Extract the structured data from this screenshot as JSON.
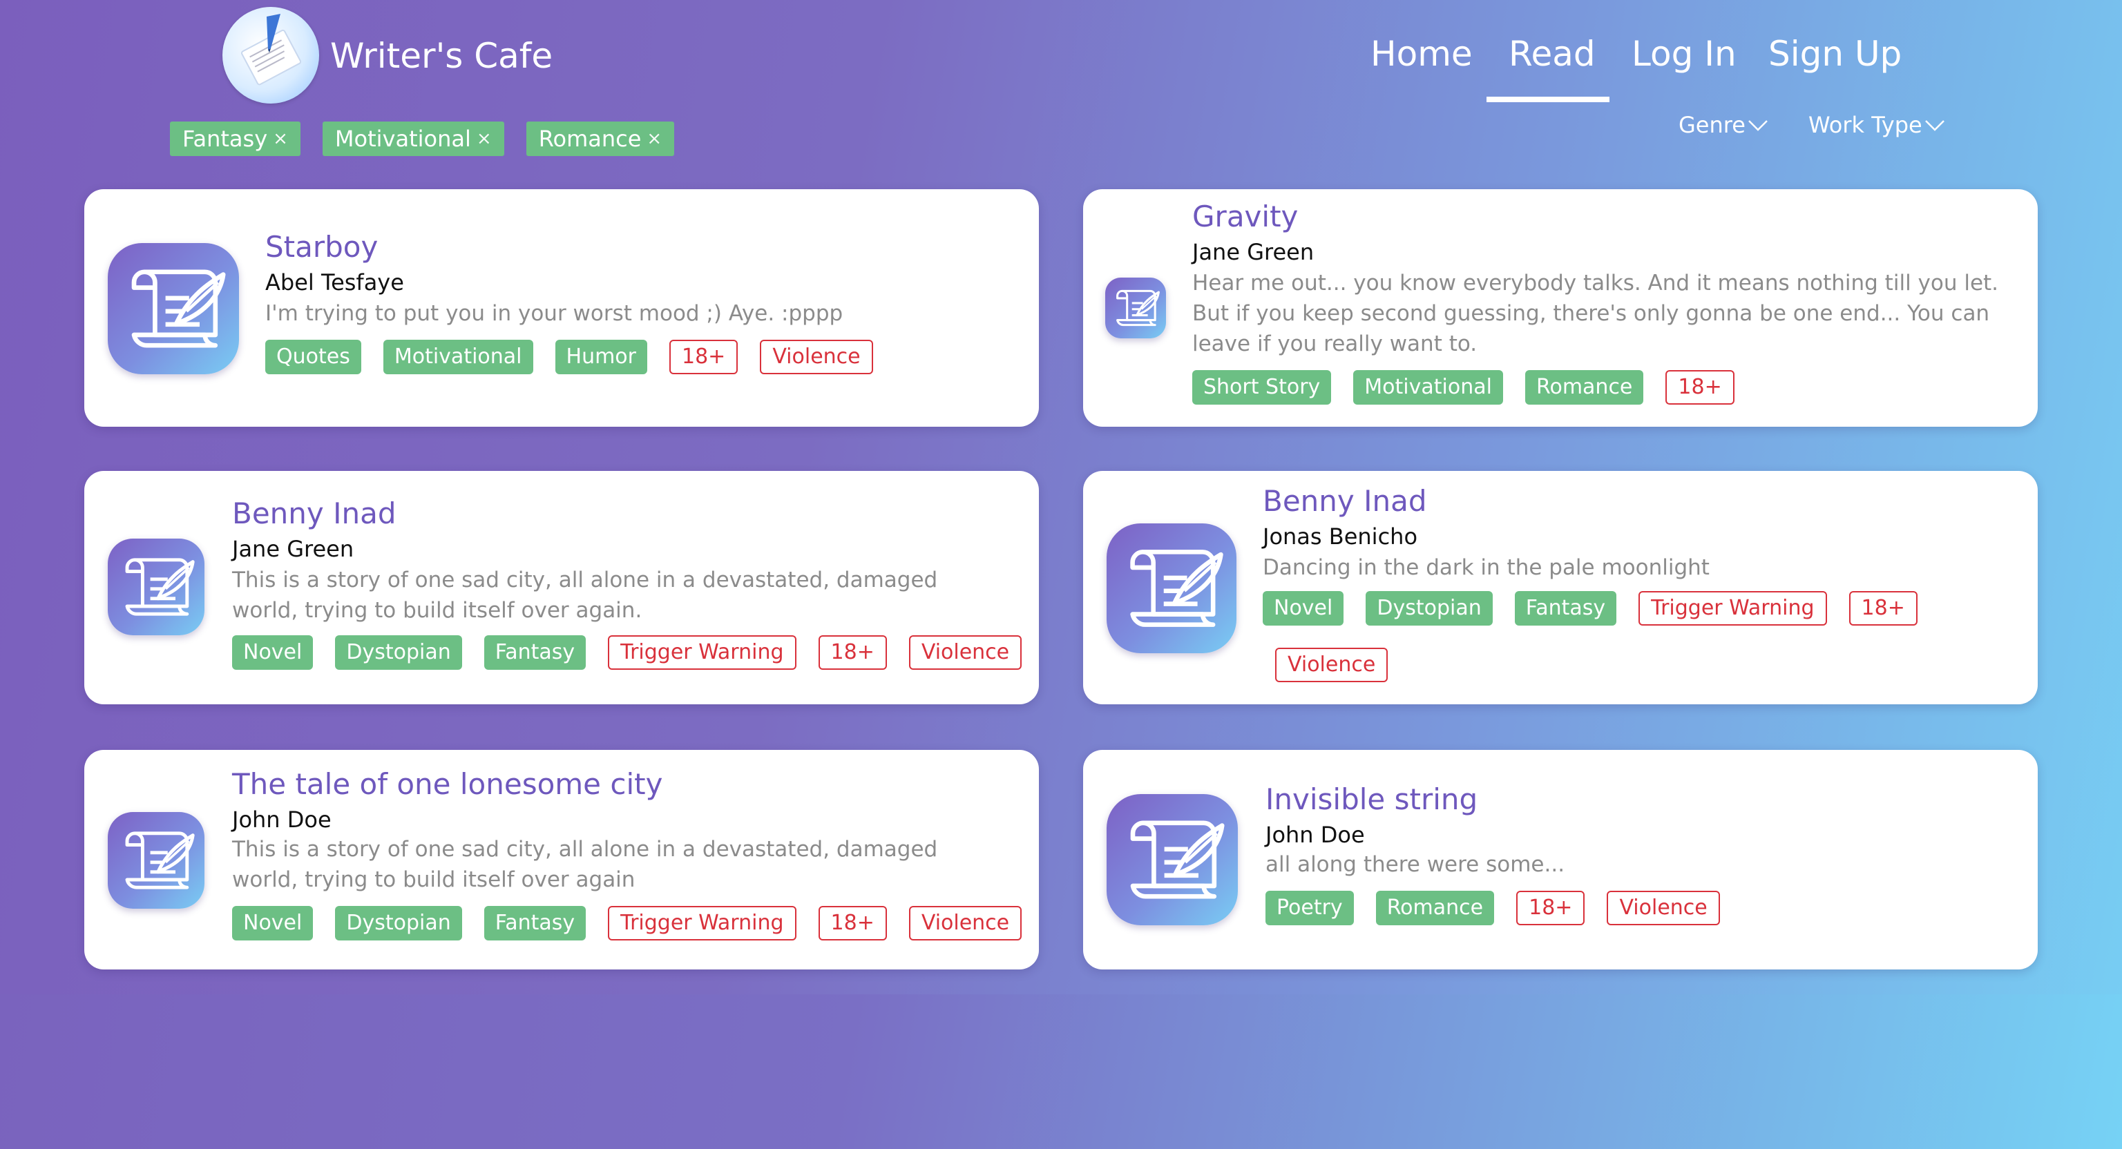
{
  "header": {
    "brand": "Writer's Cafe",
    "nav": {
      "home": "Home",
      "read": "Read",
      "login": "Log In",
      "signup": "Sign Up"
    },
    "active_nav": "Read",
    "filters": [
      {
        "label": "Fantasy",
        "close": "×"
      },
      {
        "label": "Motivational",
        "close": "×"
      },
      {
        "label": "Romance",
        "close": "×"
      }
    ],
    "dropdowns": {
      "genre": "Genre",
      "work_type": "Work Type"
    }
  },
  "colors": {
    "title": "#6e58bd",
    "green_tag": "#6cbf84",
    "red_tag": "#d9313b",
    "bg_start": "#7b5fbd",
    "bg_end": "#77cff4"
  },
  "works": [
    {
      "title": "Starboy",
      "author": "Abel Tesfaye",
      "description": "I'm trying to put you in your worst mood ;) Aye. :pppp",
      "tags": [
        {
          "label": "Quotes",
          "style": "green"
        },
        {
          "label": "Motivational",
          "style": "green"
        },
        {
          "label": "Humor",
          "style": "green"
        },
        {
          "label": "18+",
          "style": "red"
        },
        {
          "label": "Violence",
          "style": "red"
        }
      ]
    },
    {
      "title": "Gravity",
      "author": "Jane Green",
      "description": "Hear me out... you know everybody talks. And it means nothing till you let. But if you keep second guessing, there's only gonna be one end... You can leave if you really want to.",
      "tags": [
        {
          "label": "Short Story",
          "style": "green"
        },
        {
          "label": "Motivational",
          "style": "green"
        },
        {
          "label": "Romance",
          "style": "green"
        },
        {
          "label": "18+",
          "style": "red"
        }
      ]
    },
    {
      "title": "Benny Inad",
      "author": "Jane Green",
      "description": "This is a story of one sad city, all alone in a devastated, damaged world, trying to build itself over again.",
      "tags": [
        {
          "label": "Novel",
          "style": "green"
        },
        {
          "label": "Dystopian",
          "style": "green"
        },
        {
          "label": "Fantasy",
          "style": "green"
        },
        {
          "label": "Trigger Warning",
          "style": "red"
        },
        {
          "label": "18+",
          "style": "red"
        },
        {
          "label": "Violence",
          "style": "red"
        }
      ]
    },
    {
      "title": "Benny Inad",
      "author": "Jonas Benicho",
      "description": "Dancing in the dark in the pale moonlight",
      "tags": [
        {
          "label": "Novel",
          "style": "green"
        },
        {
          "label": "Dystopian",
          "style": "green"
        },
        {
          "label": "Fantasy",
          "style": "green"
        },
        {
          "label": "Trigger Warning",
          "style": "red"
        },
        {
          "label": "18+",
          "style": "red"
        },
        {
          "label": "Violence",
          "style": "red"
        }
      ]
    },
    {
      "title": "The tale of one lonesome city",
      "author": "John Doe",
      "description": "This is a story of one sad city, all alone in a devastated, damaged world, trying to build itself over again",
      "tags": [
        {
          "label": "Novel",
          "style": "green"
        },
        {
          "label": "Dystopian",
          "style": "green"
        },
        {
          "label": "Fantasy",
          "style": "green"
        },
        {
          "label": "Trigger Warning",
          "style": "red"
        },
        {
          "label": "18+",
          "style": "red"
        },
        {
          "label": "Violence",
          "style": "red"
        }
      ]
    },
    {
      "title": "Invisible string",
      "author": "John Doe",
      "description": "all along there were some...",
      "tags": [
        {
          "label": "Poetry",
          "style": "green"
        },
        {
          "label": "Romance",
          "style": "green"
        },
        {
          "label": "18+",
          "style": "red"
        },
        {
          "label": "Violence",
          "style": "red"
        }
      ]
    }
  ]
}
